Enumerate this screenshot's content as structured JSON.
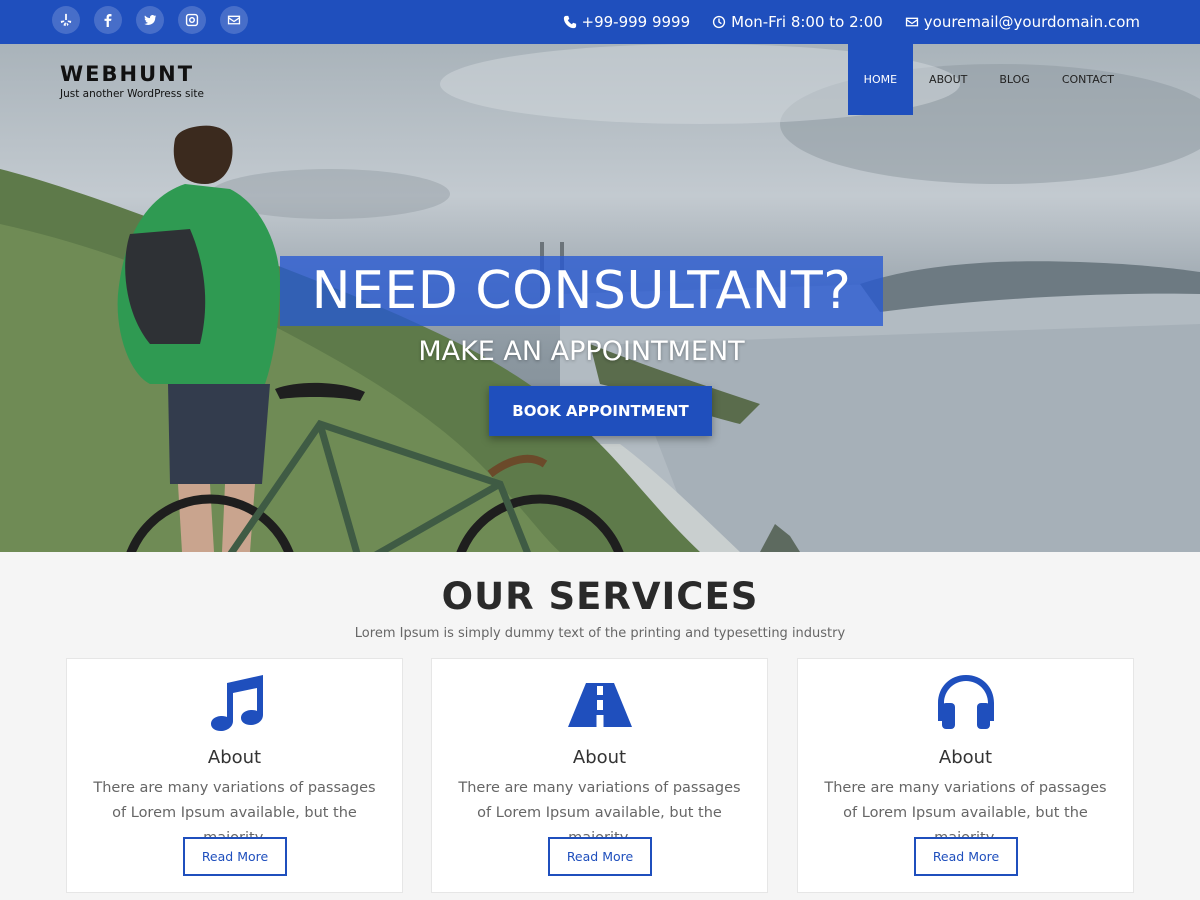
{
  "topbar": {
    "social_icons": [
      "yelp-icon",
      "facebook-icon",
      "twitter-icon",
      "instagram-icon",
      "email-icon"
    ],
    "phone": "+99-999 9999",
    "hours": "Mon-Fri 8:00 to 2:00",
    "email": "youremail@yourdomain.com"
  },
  "site": {
    "title": "WEBHUNT",
    "tagline": "Just another WordPress site"
  },
  "nav": {
    "items": [
      {
        "label": "HOME",
        "active": true
      },
      {
        "label": "ABOUT",
        "active": false
      },
      {
        "label": "BLOG",
        "active": false
      },
      {
        "label": "CONTACT",
        "active": false
      }
    ]
  },
  "hero": {
    "headline": "NEED CONSULTANT?",
    "subheadline": "MAKE AN APPOINTMENT",
    "button_label": "BOOK APPOINTMENT"
  },
  "services": {
    "title": "OUR SERVICES",
    "subtitle": "Lorem Ipsum is simply dummy text of the printing and typesetting industry",
    "cards": [
      {
        "icon": "music-note-icon",
        "title": "About",
        "text": "There are many variations of passages of Lorem Ipsum available, but the majority.",
        "button": "Read More"
      },
      {
        "icon": "road-icon",
        "title": "About",
        "text": "There are many variations of passages of Lorem Ipsum available, but the majority.",
        "button": "Read More"
      },
      {
        "icon": "headphones-icon",
        "title": "About",
        "text": "There are many variations of passages of Lorem Ipsum available, but the majority.",
        "button": "Read More"
      }
    ]
  },
  "colors": {
    "primary": "#1f4fbd",
    "background": "#f5f5f5",
    "card": "#ffffff"
  }
}
